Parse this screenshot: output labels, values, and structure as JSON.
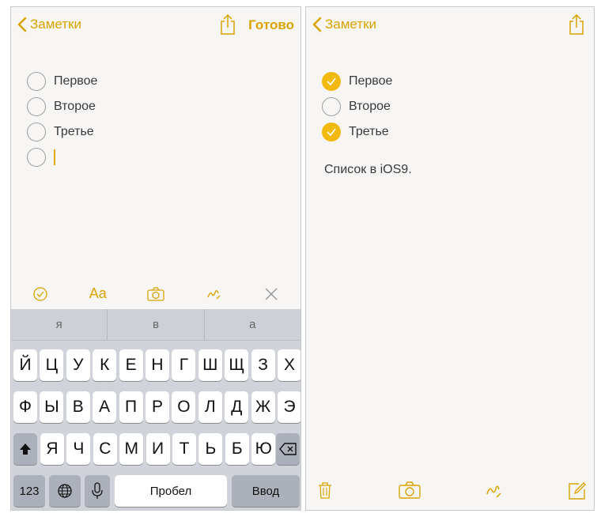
{
  "accent_color": "#d9a400",
  "left": {
    "nav": {
      "back_label": "Заметки",
      "done_label": "Готово"
    },
    "checklist": [
      {
        "text": "Первое",
        "checked": false
      },
      {
        "text": "Второе",
        "checked": false
      },
      {
        "text": "Третье",
        "checked": false
      }
    ],
    "format_bar": [
      "checklist-icon",
      "text-format-icon",
      "camera-icon",
      "sketch-icon",
      "close-icon"
    ],
    "format_text_label": "Aa",
    "keyboard": {
      "suggestions": [
        "я",
        "в",
        "а"
      ],
      "row1": [
        "Й",
        "Ц",
        "У",
        "К",
        "Е",
        "Н",
        "Г",
        "Ш",
        "Щ",
        "З",
        "Х"
      ],
      "row2": [
        "Ф",
        "Ы",
        "В",
        "А",
        "П",
        "Р",
        "О",
        "Л",
        "Д",
        "Ж",
        "Э"
      ],
      "row3": [
        "Я",
        "Ч",
        "С",
        "М",
        "И",
        "Т",
        "Ь",
        "Б",
        "Ю"
      ],
      "numbers_label": "123",
      "space_label": "Пробел",
      "return_label": "Ввод"
    }
  },
  "right": {
    "nav": {
      "back_label": "Заметки"
    },
    "checklist": [
      {
        "text": "Первое",
        "checked": true
      },
      {
        "text": "Второе",
        "checked": false
      },
      {
        "text": "Третье",
        "checked": true
      }
    ],
    "note_text": "Список в iOS9.",
    "bottom_bar": [
      "trash-icon",
      "camera-icon",
      "sketch-icon",
      "compose-icon"
    ]
  }
}
